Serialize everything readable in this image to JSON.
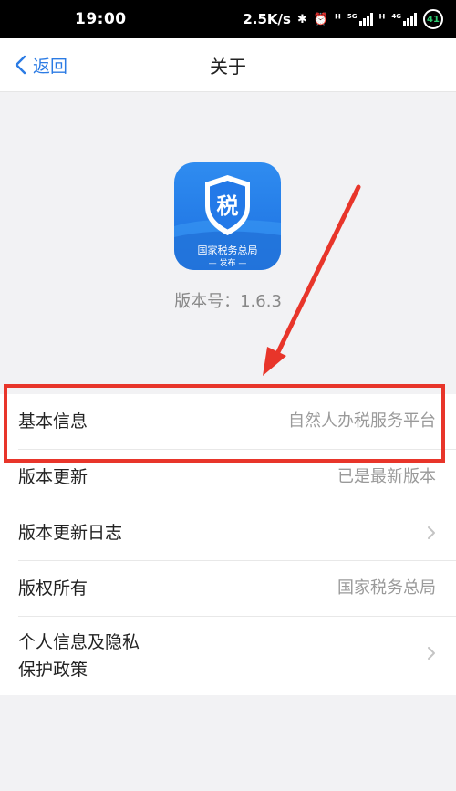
{
  "status_bar": {
    "time": "19:00",
    "net_speed": "2.5K/s",
    "icons": [
      "bluetooth-icon",
      "alarm-icon",
      "volte-icon",
      "signal-5g-icon",
      "volte-icon-2",
      "signal-4g-icon",
      "battery-icon"
    ],
    "signal_tags": [
      "5G",
      "4G"
    ],
    "battery_level": "41"
  },
  "nav": {
    "back_label": "返回",
    "title": "关于"
  },
  "app": {
    "icon_char": "税",
    "caption_main": "国家税务总局",
    "caption_sub": "— 发布 —",
    "version_label": "版本号：",
    "version_number": "1.6.3"
  },
  "list": {
    "items": [
      {
        "label": "基本信息",
        "value": "自然人办税服务平台"
      },
      {
        "label": "版本更新",
        "value": "已是最新版本"
      },
      {
        "label": "版本更新日志",
        "value": "",
        "chevron": true
      },
      {
        "label": "版权所有",
        "value": "国家税务总局"
      },
      {
        "label": "个人信息及隐私保护政策",
        "value": "",
        "chevron": true
      }
    ]
  },
  "colors": {
    "accent": "#2b7be4",
    "annotation": "#e8352a",
    "icon_blue": "#1c6fe0"
  }
}
